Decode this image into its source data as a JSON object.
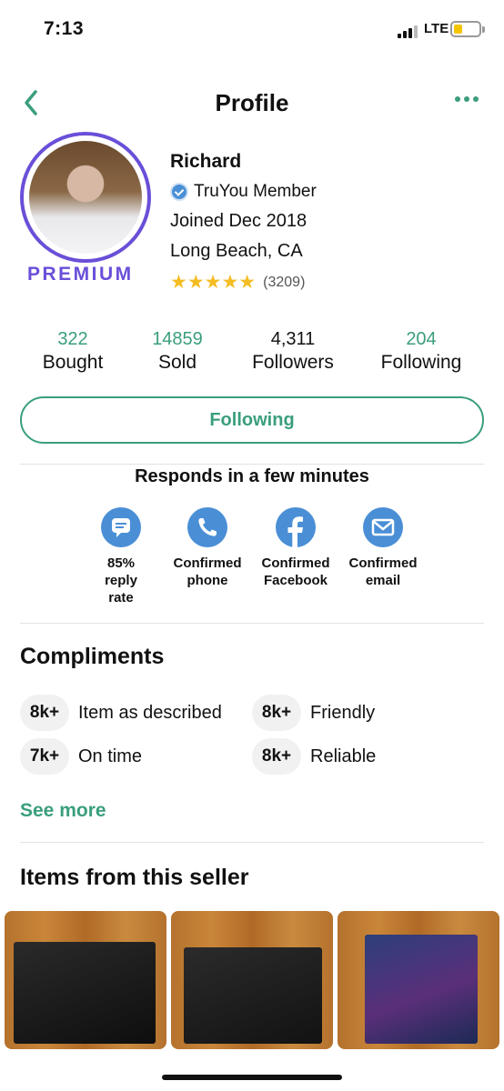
{
  "status": {
    "time": "7:13",
    "network": "LTE"
  },
  "header": {
    "title": "Profile"
  },
  "profile": {
    "name": "Richard",
    "member_badge": "TruYou Member",
    "joined": "Joined Dec 2018",
    "location": "Long Beach, CA",
    "premium_label": "PREMIUM",
    "stars": "★★★★★",
    "rating_count": "(3209)"
  },
  "stats": [
    {
      "value": "322",
      "label": "Bought"
    },
    {
      "value": "14859",
      "label": "Sold"
    },
    {
      "value": "4,311",
      "label": "Followers"
    },
    {
      "value": "204",
      "label": "Following"
    }
  ],
  "follow_button": "Following",
  "responds": "Responds in a few minutes",
  "verifications": [
    {
      "icon": "chat-bubble-icon",
      "line1": "85%",
      "line2": "reply",
      "line3": "rate"
    },
    {
      "icon": "phone-icon",
      "line1": "Confirmed",
      "line2": "phone"
    },
    {
      "icon": "facebook-icon",
      "line1": "Confirmed",
      "line2": "Facebook"
    },
    {
      "icon": "email-icon",
      "line1": "Confirmed",
      "line2": "email"
    }
  ],
  "compliments": {
    "title": "Compliments",
    "items": [
      {
        "count": "8k+",
        "label": "Item as described"
      },
      {
        "count": "8k+",
        "label": "Friendly"
      },
      {
        "count": "7k+",
        "label": "On time"
      },
      {
        "count": "8k+",
        "label": "Reliable"
      }
    ],
    "see_more": "See more"
  },
  "items_section": {
    "title": "Items from this seller"
  },
  "colors": {
    "accent": "#3a9e7d",
    "premium": "#6a4fd8",
    "star": "#f4bd23",
    "icon_blue": "#4a8fd6"
  }
}
